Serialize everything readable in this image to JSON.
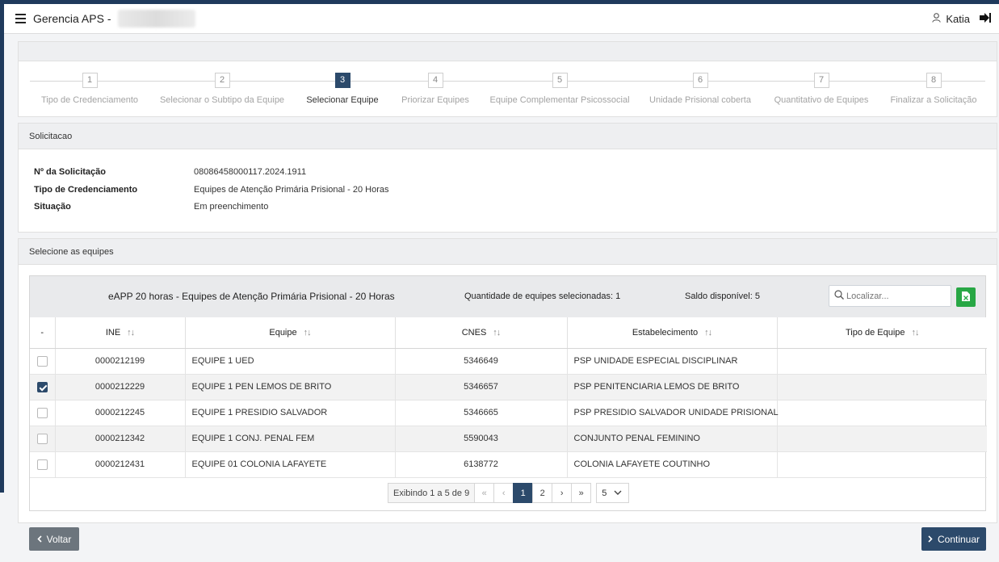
{
  "header": {
    "menu_icon": "hamburger-icon",
    "app_title": "Gerencia APS -",
    "user_name": "Katia",
    "user_icon": "user-icon",
    "logout_icon": "logout-icon"
  },
  "stepper": {
    "steps": [
      {
        "num": "1",
        "label": "Tipo de Credenciamento"
      },
      {
        "num": "2",
        "label": "Selecionar o Subtipo da Equipe"
      },
      {
        "num": "3",
        "label": "Selecionar Equipe"
      },
      {
        "num": "4",
        "label": "Priorizar Equipes"
      },
      {
        "num": "5",
        "label": "Equipe Complementar Psicossocial"
      },
      {
        "num": "6",
        "label": "Unidade Prisional coberta"
      },
      {
        "num": "7",
        "label": "Quantitativo de Equipes"
      },
      {
        "num": "8",
        "label": "Finalizar a Solicitação"
      }
    ],
    "active_step": "3"
  },
  "solicitacao": {
    "heading": "Solicitacao",
    "fields": [
      {
        "label": "Nº da Solicitação",
        "value": "08086458000117.2024.1911"
      },
      {
        "label": "Tipo de Credenciamento",
        "value": "Equipes de Atenção Primária Prisional - 20 Horas"
      },
      {
        "label": "Situação",
        "value": "Em preenchimento"
      }
    ]
  },
  "equipes": {
    "heading": "Selecione as equipes",
    "table_title": "eAPP 20 horas - Equipes de Atenção Primária Prisional - 20 Horas",
    "selected_label": "Quantidade de equipes selecionadas:",
    "selected_count": "1",
    "saldo_label": "Saldo disponível:",
    "saldo_value": "5",
    "search_placeholder": "Localizar...",
    "export_icon": "excel-file-icon",
    "columns": [
      "-",
      "INE",
      "Equipe",
      "CNES",
      "Estabelecimento",
      "Tipo de Equipe"
    ],
    "rows": [
      {
        "checked": false,
        "ine": "0000212199",
        "equipe": "EQUIPE 1 UED",
        "cnes": "5346649",
        "estabelecimento": "PSP UNIDADE ESPECIAL DISCIPLINAR",
        "tipo": ""
      },
      {
        "checked": true,
        "ine": "0000212229",
        "equipe": "EQUIPE 1 PEN LEMOS DE BRITO",
        "cnes": "5346657",
        "estabelecimento": "PSP PENITENCIARIA LEMOS DE BRITO",
        "tipo": ""
      },
      {
        "checked": false,
        "ine": "0000212245",
        "equipe": "EQUIPE 1 PRESIDIO SALVADOR",
        "cnes": "5346665",
        "estabelecimento": "PSP PRESIDIO SALVADOR UNIDADE PRISIONAL",
        "tipo": ""
      },
      {
        "checked": false,
        "ine": "0000212342",
        "equipe": "EQUIPE 1 CONJ. PENAL FEM",
        "cnes": "5590043",
        "estabelecimento": "CONJUNTO PENAL FEMININO",
        "tipo": ""
      },
      {
        "checked": false,
        "ine": "0000212431",
        "equipe": "EQUIPE 01 COLONIA LAFAYETE",
        "cnes": "6138772",
        "estabelecimento": "COLONIA LAFAYETE COUTINHO",
        "tipo": ""
      }
    ],
    "pagination": {
      "info": "Exibindo 1 a 5 de 9",
      "first": "«",
      "prev": "‹",
      "pages": [
        "1",
        "2"
      ],
      "current_page": "1",
      "next": "›",
      "last": "»",
      "page_size": "5"
    }
  },
  "footer": {
    "back_label": "Voltar",
    "next_label": "Continuar"
  },
  "colors": {
    "primary": "#2c4a6b",
    "secondary": "#6c757d",
    "success": "#28a745"
  }
}
